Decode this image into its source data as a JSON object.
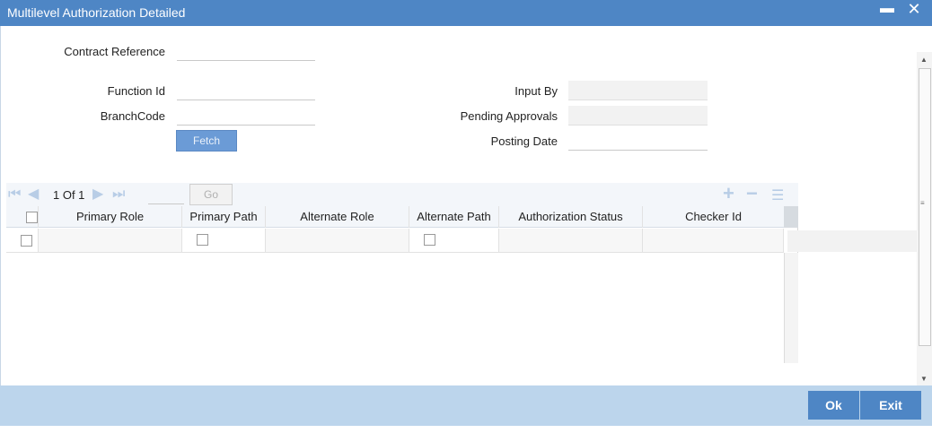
{
  "window": {
    "title": "Multilevel Authorization Detailed",
    "minimize_glyph": "▬",
    "close_glyph": "✕"
  },
  "form": {
    "contract_reference_label": "Contract Reference",
    "function_id_label": "Function Id",
    "branch_code_label": "BranchCode",
    "input_by_label": "Input By",
    "pending_approvals_label": "Pending Approvals",
    "posting_date_label": "Posting Date",
    "contract_reference_value": "",
    "function_id_value": "",
    "branch_code_value": "",
    "input_by_value": "",
    "pending_approvals_value": "",
    "posting_date_value": "",
    "fetch_label": "Fetch"
  },
  "pager": {
    "page_text": "1 Of 1",
    "go_label": "Go",
    "page_input_value": ""
  },
  "grid": {
    "columns": [
      "Primary Role",
      "Primary Path",
      "Alternate Role",
      "Alternate Path",
      "Authorization Status",
      "Checker Id"
    ]
  },
  "footer": {
    "ok_label": "Ok",
    "exit_label": "Exit"
  },
  "colors": {
    "titlebar": "#4e86c5",
    "footer": "#bcd5ec",
    "button": "#4e86c5",
    "fetch_button": "#6b9bd6"
  }
}
